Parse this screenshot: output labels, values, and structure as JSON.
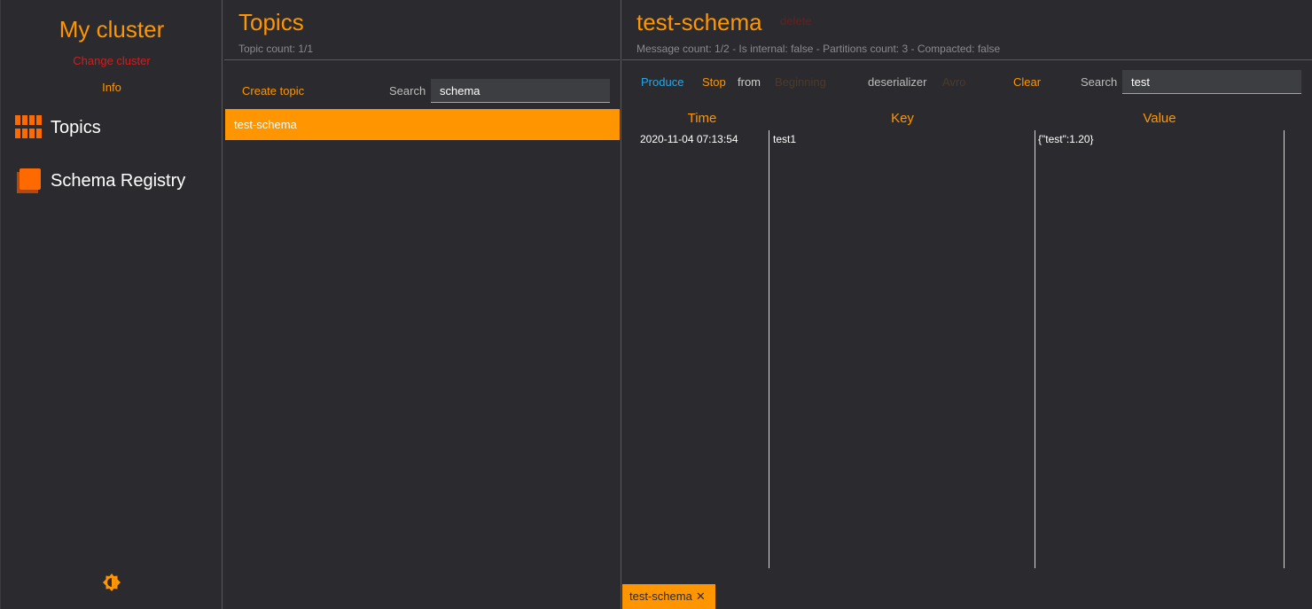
{
  "sidebar": {
    "cluster_name": "My cluster",
    "change_cluster": "Change cluster",
    "info": "Info",
    "items": [
      {
        "label": "Topics",
        "icon": "topics-icon"
      },
      {
        "label": "Schema Registry",
        "icon": "schema-registry-icon"
      }
    ],
    "theme_icon": "theme-toggle-icon"
  },
  "topics_panel": {
    "title": "Topics",
    "count": "Topic count: 1/1",
    "create_topic": "Create topic",
    "search_label": "Search",
    "search_value": "schema",
    "topics": [
      "test-schema"
    ]
  },
  "detail": {
    "title": "test-schema",
    "delete": "delete",
    "summary": "Message count: 1/2 - Is internal: false - Partitions count: 3 - Compacted: false",
    "toolbar": {
      "produce": "Produce",
      "stop": "Stop",
      "from": "from",
      "from_value": "Beginning",
      "deserializer": "deserializer",
      "deserializer_value": "Avro",
      "clear": "Clear",
      "search_label": "Search",
      "search_value": "test"
    },
    "columns": [
      "Time",
      "Key",
      "Value"
    ],
    "rows": [
      {
        "time": "2020-11-04 07:13:54",
        "key": "test1",
        "value": "{\"test\":1.20}"
      }
    ],
    "tab": "test-schema"
  },
  "colors": {
    "accent": "#ff9500",
    "background": "#2b2b2f",
    "danger": "#d31d1d",
    "link_blue": "#29a6e6"
  }
}
